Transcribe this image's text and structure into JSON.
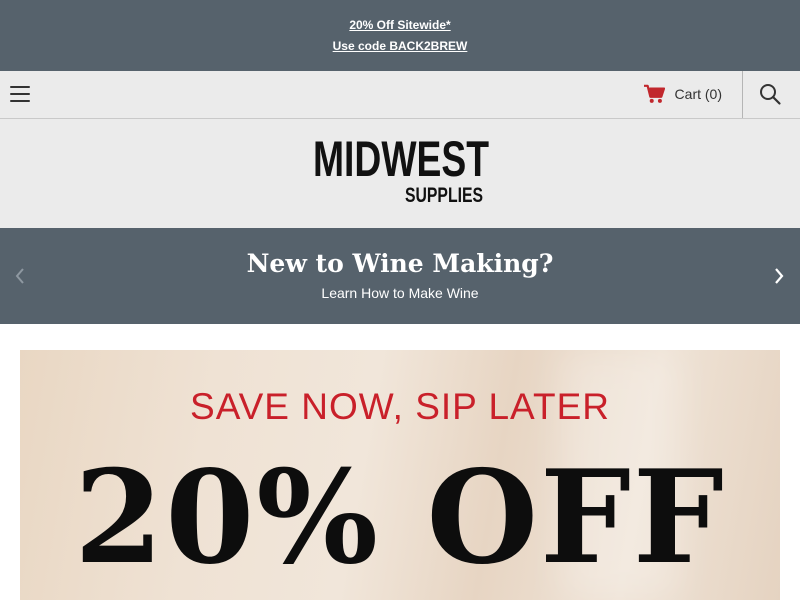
{
  "promo": {
    "line1": "20% Off Sitewide*",
    "line2": "Use code BACK2BREW"
  },
  "nav": {
    "menu_icon": "hamburger-icon",
    "cart_label": "Cart (0)",
    "cart_icon": "shopping-cart-icon",
    "search_icon": "search-icon"
  },
  "logo": {
    "word1": "MIDWEST",
    "word2": "SUPPLIES"
  },
  "slider": {
    "title": "New to Wine Making?",
    "subtitle": "Learn How to Make Wine",
    "prev_icon": "chevron-left-icon",
    "next_icon": "chevron-right-icon"
  },
  "hero": {
    "tagline": "SAVE NOW, SIP LATER",
    "offer": "20% OFF"
  },
  "colors": {
    "bar_bg": "#56626c",
    "nav_bg": "#ebebeb",
    "cart_red": "#c1272d",
    "tagline_red": "#c9202a"
  }
}
